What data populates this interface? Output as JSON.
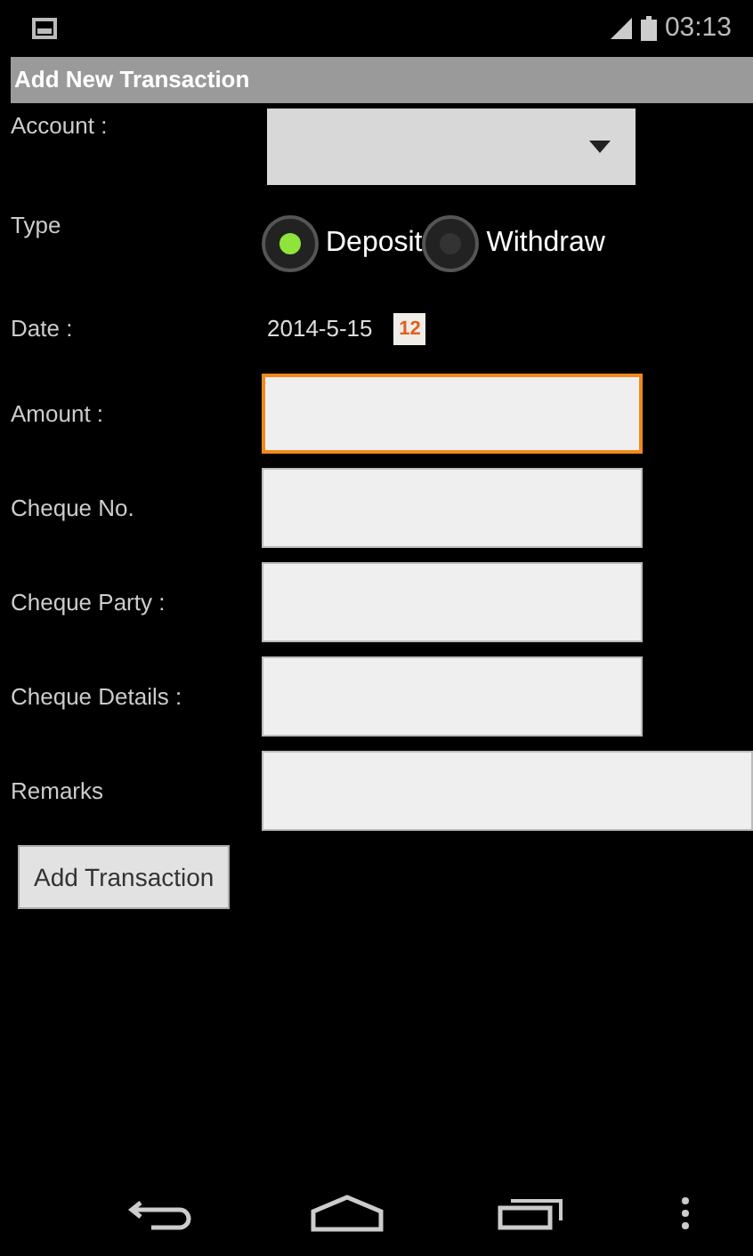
{
  "status_bar": {
    "time": "03:13"
  },
  "title_bar": {
    "title": "Add New Transaction"
  },
  "form": {
    "account": {
      "label": "Account :"
    },
    "type": {
      "label": "Type",
      "options": [
        {
          "label": "Deposit",
          "selected": true
        },
        {
          "label": "Withdraw",
          "selected": false
        }
      ]
    },
    "date": {
      "label": "Date :",
      "value": "2014-5-15",
      "calendar_day": "12"
    },
    "fields": [
      {
        "label": "Amount :",
        "focused": true,
        "wide": false
      },
      {
        "label": "Cheque No.",
        "focused": false,
        "wide": false
      },
      {
        "label": "Cheque Party :",
        "focused": false,
        "wide": false
      },
      {
        "label": "Cheque Details :",
        "focused": false,
        "wide": false
      },
      {
        "label": "Remarks",
        "focused": false,
        "wide": true
      }
    ],
    "submit": "Add Transaction"
  }
}
